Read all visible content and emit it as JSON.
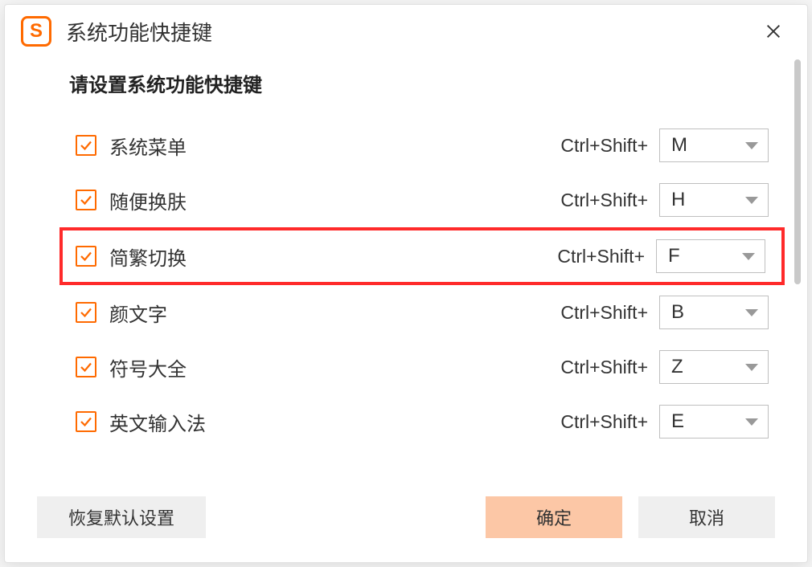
{
  "window": {
    "title": "系统功能快捷键",
    "app_icon_letter": "S"
  },
  "section_title": "请设置系统功能快捷键",
  "modifier_prefix": "Ctrl+Shift+",
  "shortcuts": [
    {
      "label": "系统菜单",
      "key": "M",
      "checked": true,
      "highlight": false
    },
    {
      "label": "随便换肤",
      "key": "H",
      "checked": true,
      "highlight": false
    },
    {
      "label": "简繁切换",
      "key": "F",
      "checked": true,
      "highlight": true
    },
    {
      "label": "颜文字",
      "key": "B",
      "checked": true,
      "highlight": false
    },
    {
      "label": "符号大全",
      "key": "Z",
      "checked": true,
      "highlight": false
    },
    {
      "label": "英文输入法",
      "key": "E",
      "checked": true,
      "highlight": false
    }
  ],
  "buttons": {
    "reset": "恢复默认设置",
    "ok": "确定",
    "cancel": "取消"
  }
}
